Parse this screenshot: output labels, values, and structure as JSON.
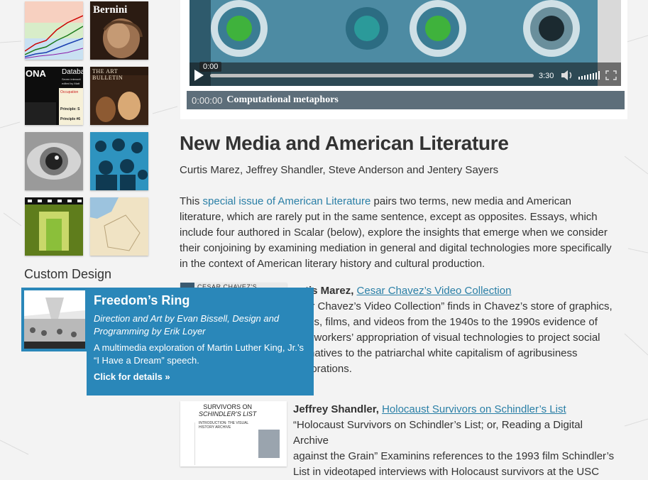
{
  "sidebar": {
    "thumbnails": [
      {
        "label": "",
        "name": "thumb-chart"
      },
      {
        "label": "Bernini",
        "name": "thumb-bernini"
      },
      {
        "label": "ONA",
        "name": "thumb-database"
      },
      {
        "label": "THE ART BULLETIN",
        "name": "thumb-art-bulletin"
      },
      {
        "label": "",
        "name": "thumb-eye"
      },
      {
        "label": "",
        "name": "thumb-crowd"
      },
      {
        "label": "",
        "name": "thumb-film"
      },
      {
        "label": "",
        "name": "thumb-map"
      }
    ],
    "database_thumb": {
      "title": "Databa",
      "line1": "Seven interacti",
      "line2": "edited by Matt",
      "red_text": "Occupation",
      "principle1": "Principle: S",
      "principle2": "Principle #6"
    },
    "custom_design": "Custom Design"
  },
  "player": {
    "tooltip_time": "0:00",
    "duration": "3:30",
    "caption_time": "0:00:00",
    "caption_title": "Computational metaphors",
    "progress": 0
  },
  "article": {
    "title": "New Media and American Literature",
    "authors": "Curtis Marez, Jeffrey Shandler, Steve Anderson and Jentery Sayers",
    "intro_before": "This ",
    "intro_link": "special issue of American Literature",
    "intro_after": " pairs two terms, new media and American literature, which are rarely put in the same sentence, except as opposites. Essays, which include four authored in Scalar (below), explore the insights that emerge when we consider their conjoining by examining mediation in general and digital technologies more specifically in the context of American literary history and cultural production."
  },
  "entries": [
    {
      "author": "tis Marez,",
      "link": "Cesar Chavez’s Video Collection",
      "thumb_title": "CESAR CHAVEZ'S",
      "body_lines": [
        "ar Chavez’s Video Collection” finds in Chavez’s store of graphics,",
        "tos, films, and videos from the 1940s to the 1990s evidence of",
        "n workers’ appropriation of visual technologies to project social",
        "rnatives to the patriarchal white capitalism of agribusiness",
        "porations."
      ]
    },
    {
      "author": "Jeffrey Shandler,",
      "link": "Holocaust Survivors on Schindler’s List",
      "thumb_title_1": "SURVIVORS ON",
      "thumb_title_2": "SCHINDLER'S LIST",
      "thumb_heading": "INTRODUCTION: THE VISUAL HISTORY ARCHIVE",
      "body_lines": [
        "“Holocaust Survivors on Schindler’s List; or, Reading a Digital Archive",
        "against the Grain” Examinins references to the 1993 film Schindler’s",
        "List in videotaped interviews with Holocaust survivors at the USC"
      ]
    }
  ],
  "popup": {
    "title": "Freedom’s Ring",
    "subtitle": "Direction and Art by Evan Bissell, Design and Programming by Erik Loyer",
    "description": "A multimedia exploration of Martin Luther King, Jr.’s “I Have a Dream” speech.",
    "link": "Click for details »"
  },
  "colors": {
    "accent": "#2a87b9",
    "link": "#2a7fa6",
    "caption_bar": "#5d6e7a"
  }
}
